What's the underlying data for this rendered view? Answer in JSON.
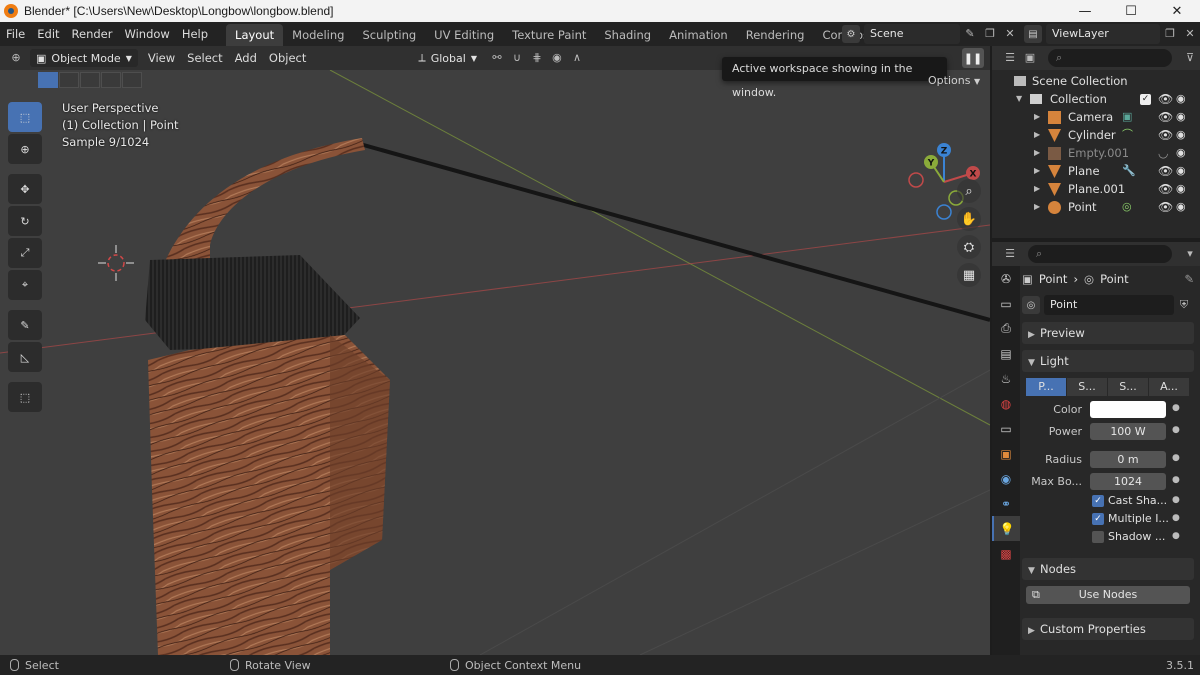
{
  "window": {
    "title": "Blender* [C:\\Users\\New\\Desktop\\Longbow\\longbow.blend]",
    "min": "—",
    "max": "☐",
    "close": "✕"
  },
  "menu": [
    "File",
    "Edit",
    "Render",
    "Window",
    "Help"
  ],
  "workspaces": [
    "Layout",
    "Modeling",
    "Sculpting",
    "UV Editing",
    "Texture Paint",
    "Shading",
    "Animation",
    "Rendering",
    "Compositing"
  ],
  "active_workspace": "Layout",
  "scene": {
    "name": "Scene",
    "view_layer": "ViewLayer"
  },
  "viewport": {
    "mode": "Object Mode",
    "menus": [
      "View",
      "Select",
      "Add",
      "Object"
    ],
    "transform_orientation": "Global",
    "overlay_lines": [
      "User Perspective",
      "(1) Collection | Point",
      "Sample 9/1024"
    ],
    "tooltip": "Active workspace showing in the window.",
    "options_label": "Options",
    "colors": {
      "background": "#3f3f3f",
      "x_axis": "#c14a4a",
      "y_axis": "#8bab3a",
      "z_axis": "#3b83d3",
      "wood": "#8a5338",
      "grip": "#1f1f1f"
    }
  },
  "gizmo": {
    "x": "X",
    "y": "Y",
    "z": "Z"
  },
  "tools": [
    "select-box",
    "cursor",
    "move",
    "rotate",
    "scale",
    "transform",
    "annotate",
    "measure",
    "add-cube"
  ],
  "outliner": {
    "root": "Scene Collection",
    "collection": "Collection",
    "items": [
      {
        "name": "Camera",
        "icon": "camera",
        "dim": false
      },
      {
        "name": "Cylinder",
        "icon": "mesh",
        "dim": false
      },
      {
        "name": "Empty.001",
        "icon": "empty",
        "dim": true
      },
      {
        "name": "Plane",
        "icon": "mesh",
        "dim": false
      },
      {
        "name": "Plane.001",
        "icon": "mesh",
        "dim": false
      },
      {
        "name": "Point",
        "icon": "light",
        "dim": false
      }
    ]
  },
  "properties": {
    "breadcrumb_object": "Point",
    "breadcrumb_data": "Point",
    "datablock": "Point",
    "panels": {
      "preview": "Preview",
      "light": "Light",
      "nodes": "Nodes",
      "custom": "Custom Properties"
    },
    "light_types": [
      "P...",
      "S...",
      "S...",
      "A..."
    ],
    "fields": [
      {
        "label": "Color",
        "value": "",
        "type": "color"
      },
      {
        "label": "Power",
        "value": "100 W",
        "type": "num"
      },
      {
        "label": "Radius",
        "value": "0 m",
        "type": "num"
      },
      {
        "label": "Max Bo...",
        "value": "1024",
        "type": "num"
      }
    ],
    "checks": [
      {
        "label": "Cast Sha...",
        "on": true
      },
      {
        "label": "Multiple I...",
        "on": true
      },
      {
        "label": "Shadow ...",
        "on": false
      }
    ],
    "use_nodes": "Use Nodes"
  },
  "status": {
    "left": "Select",
    "middle": "Rotate View",
    "right": "Object Context Menu",
    "version": "3.5.1"
  }
}
